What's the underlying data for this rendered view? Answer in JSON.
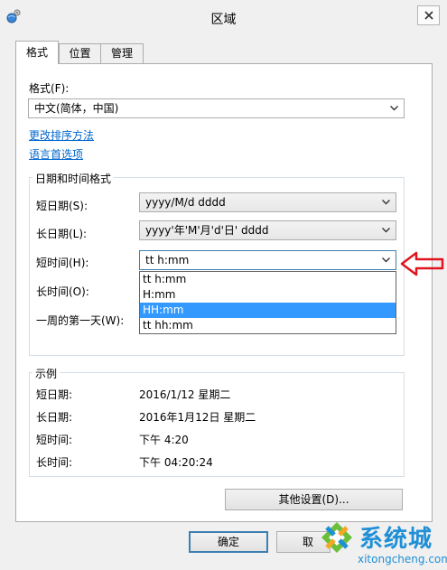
{
  "window": {
    "title": "区域"
  },
  "tabs": [
    {
      "label": "格式"
    },
    {
      "label": "位置"
    },
    {
      "label": "管理"
    }
  ],
  "format": {
    "label": "格式(F):",
    "value": "中文(简体，中国)",
    "link_sort": "更改排序方法",
    "link_lang": "语言首选项"
  },
  "datetime": {
    "group_title": "日期和时间格式",
    "rows": [
      {
        "label": "短日期(S):",
        "value": "yyyy/M/d dddd"
      },
      {
        "label": "长日期(L):",
        "value": "yyyy'年'M'月'd'日' dddd"
      },
      {
        "label": "短时间(H):",
        "value": "tt h:mm"
      },
      {
        "label": "长时间(O):",
        "value": ""
      },
      {
        "label": "一周的第一天(W):",
        "value": ""
      }
    ],
    "dropdown_options": [
      "tt h:mm",
      "H:mm",
      "HH:mm",
      "tt hh:mm"
    ],
    "dropdown_selected_index": 2
  },
  "example": {
    "group_title": "示例",
    "rows": [
      {
        "label": "短日期:",
        "value": "2016/1/12 星期二"
      },
      {
        "label": "长日期:",
        "value": "2016年1月12日 星期二"
      },
      {
        "label": "短时间:",
        "value": "下午 4:20"
      },
      {
        "label": "长时间:",
        "value": "下午 04:20:24"
      }
    ]
  },
  "buttons": {
    "other_settings": "其他设置(D)...",
    "ok": "确定",
    "cancel": "取"
  },
  "watermark": {
    "brand": "系统城",
    "url": "xitongcheng.com"
  },
  "colors": {
    "accent": "#3399ff",
    "link": "#0066cc",
    "arrow": "#e0141e"
  }
}
